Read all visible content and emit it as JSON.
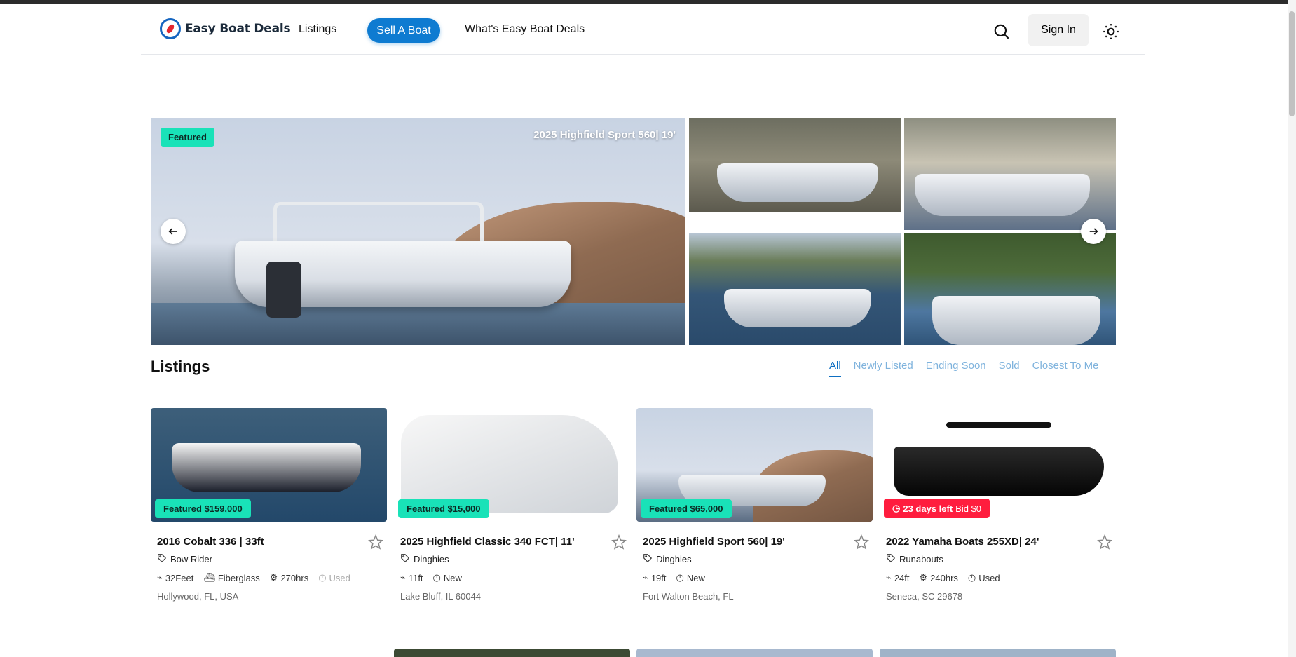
{
  "brand": {
    "name": "Easy Boat Deals"
  },
  "nav": {
    "listings": "Listings",
    "sell": "Sell A Boat",
    "about": "What's Easy Boat Deals",
    "signin": "Sign In"
  },
  "hero": {
    "badge": "Featured",
    "title": "2025 Highfield Sport 560| 19'"
  },
  "listings": {
    "heading": "Listings",
    "tabs": [
      "All",
      "Newly Listed",
      "Ending Soon",
      "Sold",
      "Closest To Me"
    ],
    "active_tab": "All",
    "cards": [
      {
        "badge": "Featured $159,000",
        "title": "2016 Cobalt 336 | 33ft",
        "category": "Bow Rider",
        "specs": [
          "32Feet",
          "Fiberglass",
          "270hrs",
          "Used"
        ],
        "location": "Hollywood, FL, USA"
      },
      {
        "badge": "Featured $15,000",
        "title": "2025 Highfield Classic 340 FCT| 11'",
        "category": "Dinghies",
        "specs": [
          "11ft",
          "New"
        ],
        "location": "Lake Bluff, IL 60044"
      },
      {
        "badge": "Featured $65,000",
        "title": "2025 Highfield Sport 560| 19'",
        "category": "Dinghies",
        "specs": [
          "19ft",
          "New"
        ],
        "location": "Fort Walton Beach, FL"
      },
      {
        "badge_days": "23 days left",
        "badge_bid": "Bid $0",
        "title": "2022 Yamaha Boats 255XD| 24'",
        "category": "Runabouts",
        "specs": [
          "24ft",
          "240hrs",
          "Used"
        ],
        "location": "Seneca, SC 29678"
      }
    ]
  },
  "colors": {
    "accent": "#0e7bd1",
    "featured": "#19e2b8",
    "auction": "#ff1d3e"
  }
}
